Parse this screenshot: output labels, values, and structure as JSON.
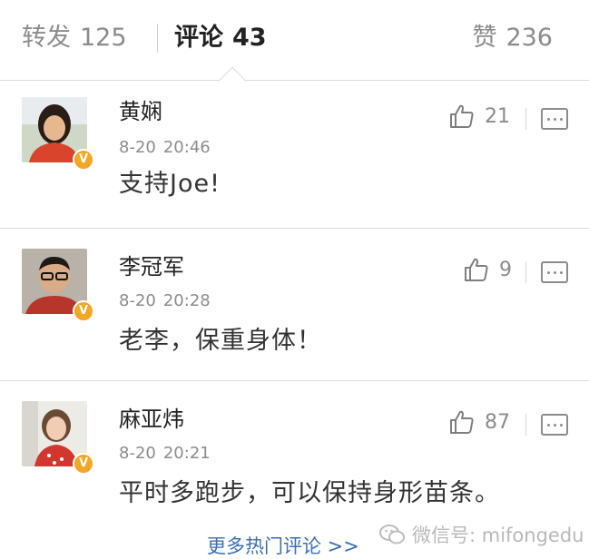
{
  "tabs": {
    "repost": {
      "label": "转发",
      "count": "125"
    },
    "comment": {
      "label": "评论",
      "count": "43"
    },
    "like": {
      "label": "赞",
      "count": "236"
    }
  },
  "comments": [
    {
      "name": "黄娴",
      "date": "8-20",
      "time": "20:46",
      "text": "支持Joe!",
      "likes": "21",
      "verified": "V"
    },
    {
      "name": "李冠军",
      "date": "8-20",
      "time": "20:28",
      "text": "老李，保重身体！",
      "likes": "9",
      "verified": "V"
    },
    {
      "name": "麻亚炜",
      "date": "8-20",
      "time": "20:21",
      "text": "平时多跑步，可以保持身形苗条。",
      "likes": "87",
      "verified": "V"
    }
  ],
  "more_link": "更多热门评论 >>",
  "watermark": "微信号: mifongedu",
  "colors": {
    "accent_link": "#3b6fb6",
    "verified_badge": "#f5a623",
    "muted_text": "#8c8c8c"
  }
}
